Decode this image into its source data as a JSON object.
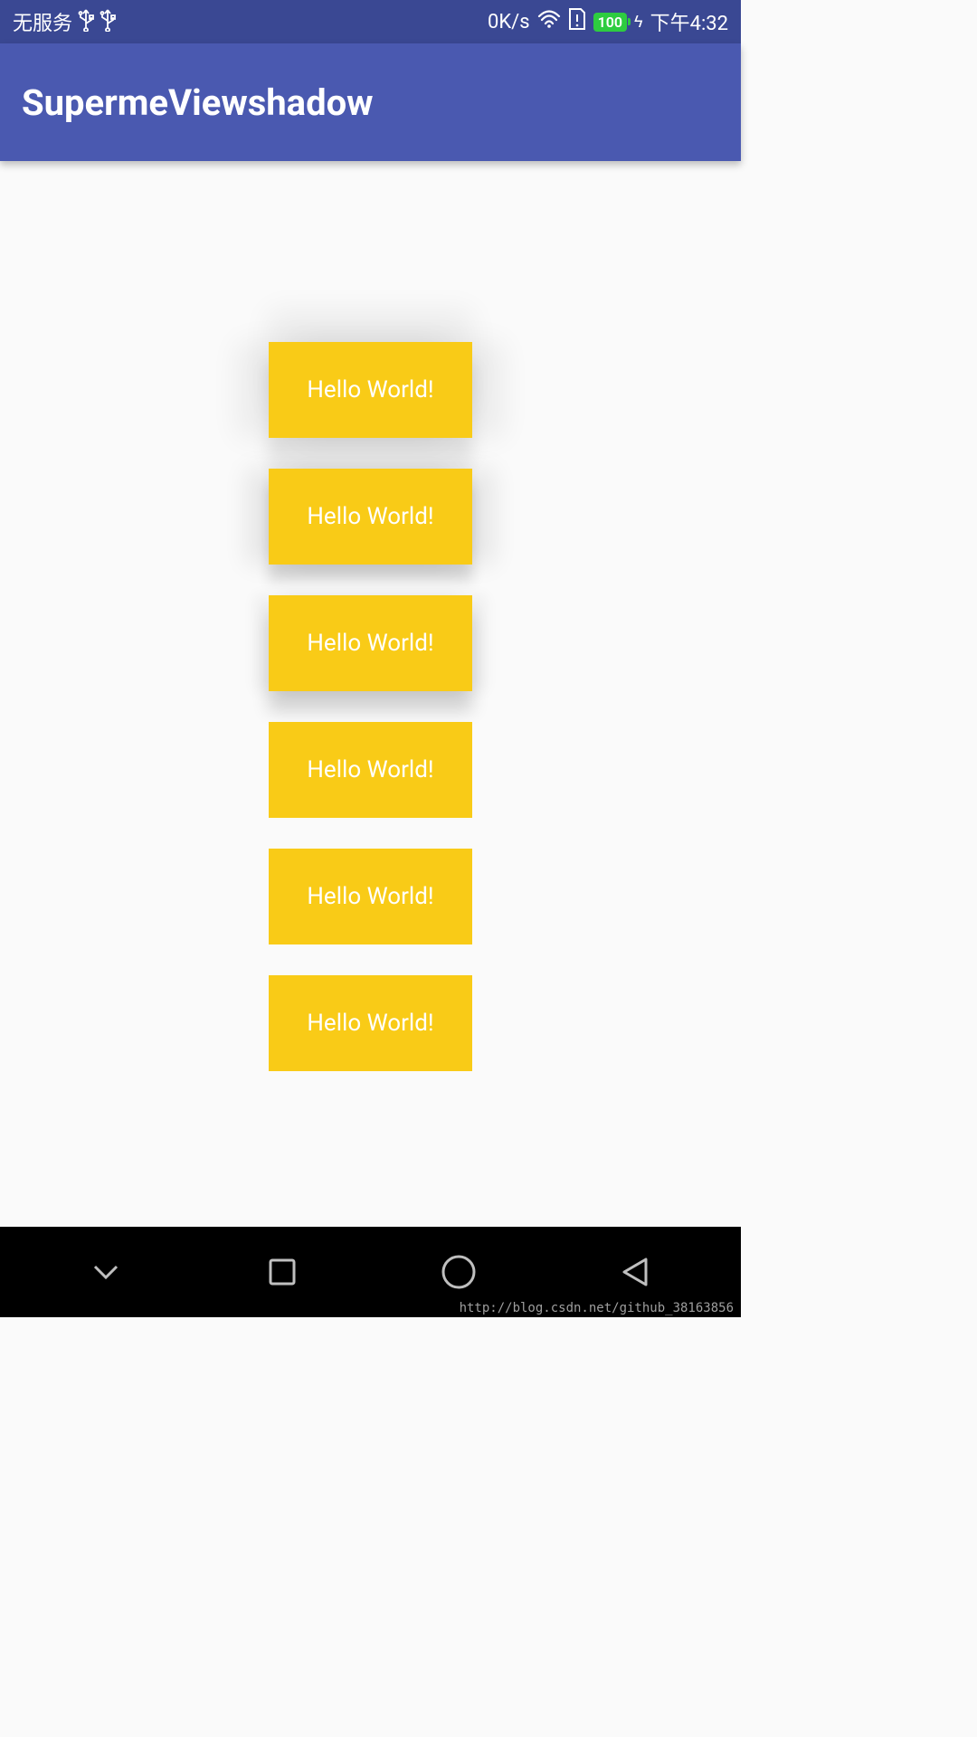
{
  "status_bar": {
    "service_text": "无服务",
    "usb_icon_1": "usb-icon",
    "usb_icon_2": "usb-icon",
    "data_rate": "0K/s",
    "wifi_icon": "wifi-icon",
    "sim_icon": "sim-alert-icon",
    "battery_level": "100",
    "charging_icon": "lightning-icon",
    "time": "下午4:32"
  },
  "app_bar": {
    "title": "SupermeViewshadow"
  },
  "cards": [
    {
      "label": "Hello World!"
    },
    {
      "label": "Hello World!"
    },
    {
      "label": "Hello World!"
    },
    {
      "label": "Hello World!"
    },
    {
      "label": "Hello World!"
    },
    {
      "label": "Hello World!"
    }
  ],
  "nav_bar": {
    "hide": "chevron-down-icon",
    "recent": "square-icon",
    "home": "circle-icon",
    "back": "triangle-left-icon"
  },
  "watermark": "http://blog.csdn.net/github_38163856"
}
